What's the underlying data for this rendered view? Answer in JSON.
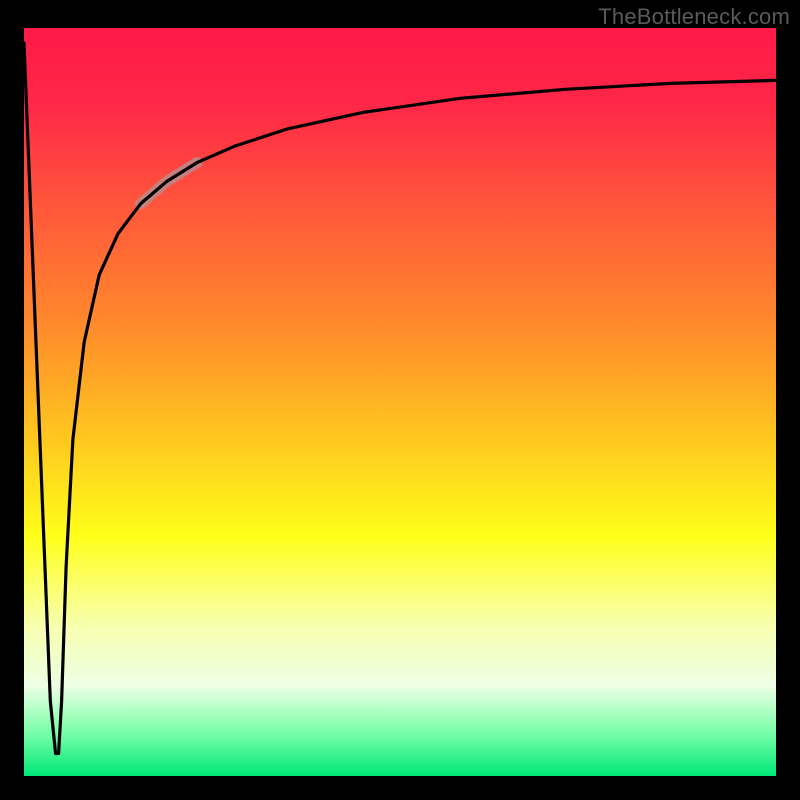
{
  "watermark": "TheBottleneck.com",
  "chart_data": {
    "type": "line",
    "title": "",
    "xlabel": "",
    "ylabel": "",
    "xlim": [
      0,
      100
    ],
    "ylim": [
      0,
      100
    ],
    "background_gradient": {
      "stops": [
        {
          "offset": 0.0,
          "color": "#ff1a47"
        },
        {
          "offset": 0.1,
          "color": "#ff2747"
        },
        {
          "offset": 0.25,
          "color": "#ff5a3a"
        },
        {
          "offset": 0.4,
          "color": "#ff8b2b"
        },
        {
          "offset": 0.55,
          "color": "#ffc81f"
        },
        {
          "offset": 0.68,
          "color": "#ffff1a"
        },
        {
          "offset": 0.8,
          "color": "#f7ffb0"
        },
        {
          "offset": 0.88,
          "color": "#ecffe4"
        },
        {
          "offset": 0.94,
          "color": "#7cffaa"
        },
        {
          "offset": 1.0,
          "color": "#00e878"
        }
      ]
    },
    "series": [
      {
        "name": "curve",
        "x": [
          0.0,
          3.5,
          4.2,
          4.6,
          5.0,
          5.6,
          6.5,
          8.0,
          10.0,
          12.5,
          15.5,
          19.0,
          23.0,
          28.0,
          35.0,
          45.0,
          58.0,
          72.0,
          86.0,
          100.0
        ],
        "y": [
          98.0,
          10.0,
          3.0,
          3.0,
          10.0,
          28.0,
          45.0,
          58.0,
          67.0,
          72.5,
          76.5,
          79.5,
          82.0,
          84.2,
          86.5,
          88.7,
          90.6,
          91.8,
          92.6,
          93.0
        ]
      }
    ],
    "highlight": {
      "series": "curve",
      "x_start": 15.5,
      "x_end": 23.0
    }
  }
}
